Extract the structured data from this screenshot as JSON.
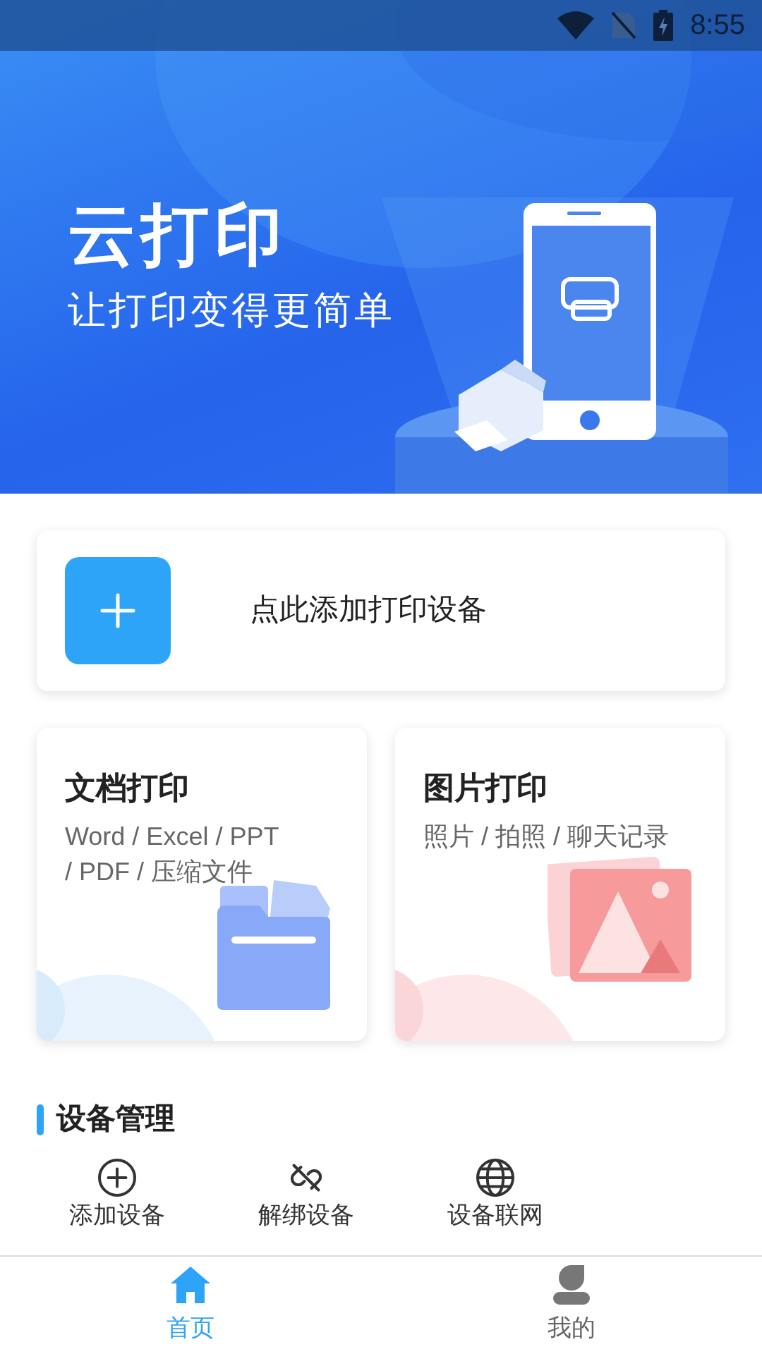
{
  "status_bar": {
    "time": "8:55"
  },
  "banner": {
    "title": "云打印",
    "subtitle": "让打印变得更简单"
  },
  "add_device_card": {
    "label": "点此添加打印设备"
  },
  "print_cards": [
    {
      "kind": "document",
      "title": "文档打印",
      "description": "Word / Excel / PPT\n/ PDF / 压缩文件"
    },
    {
      "title": "图片打印",
      "description": "照片 / 拍照 / 聊天记录"
    }
  ],
  "device_management": {
    "title": "设备管理",
    "actions": [
      {
        "kind": "add",
        "label": "添加设备"
      },
      {
        "kind": "unbind",
        "label": "解绑设备"
      },
      {
        "kind": "network",
        "label": "设备联网"
      }
    ]
  },
  "bottom_nav": [
    {
      "kind": "home",
      "label": "首页",
      "selected": true
    },
    {
      "kind": "profile",
      "label": "我的",
      "selected": false
    }
  ]
}
